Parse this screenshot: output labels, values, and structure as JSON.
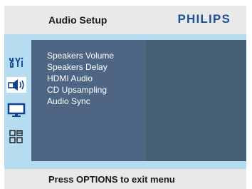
{
  "header": {
    "title": "Audio Setup",
    "brand": "PHILIPS"
  },
  "menu": {
    "items": [
      "Speakers Volume",
      "Speakers Delay",
      "HDMI Audio",
      "CD Upsampling",
      "Audio Sync"
    ]
  },
  "sidebar": {
    "icons": [
      {
        "name": "general-settings-icon",
        "selected": false
      },
      {
        "name": "audio-speaker-icon",
        "selected": true
      },
      {
        "name": "video-monitor-icon",
        "selected": false
      },
      {
        "name": "preferences-icon",
        "selected": false
      }
    ]
  },
  "footer": {
    "hint": "Press OPTIONS to exit menu"
  },
  "colors": {
    "brand": "#1d4f95",
    "content_bg": "#b5dcef",
    "menu_panel": "#4e6584",
    "preview_panel": "#486073",
    "icon_blue": "#0f3f8f",
    "bar_bg": "#e9e9e9"
  }
}
